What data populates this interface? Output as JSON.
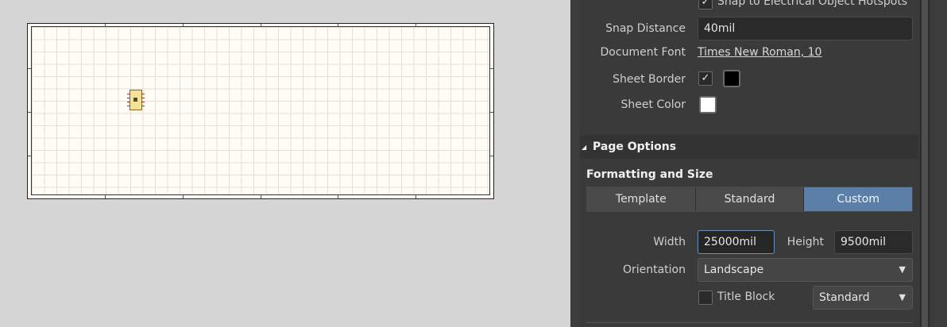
{
  "properties": {
    "snap_hotspots_label": "Snap to Electrical Object Hotspots",
    "snap_distance_label": "Snap Distance",
    "snap_distance_value": "40mil",
    "document_font_label": "Document Font",
    "document_font_value": "Times New Roman, 10",
    "sheet_border_label": "Sheet Border",
    "sheet_border_color": "#000000",
    "sheet_color_label": "Sheet Color",
    "sheet_color": "#ffffff",
    "check_glyph": "✓"
  },
  "page_options": {
    "section_title": "Page Options",
    "collapse_glyph": "◢",
    "formatting_title": "Formatting and Size",
    "modes": [
      {
        "label": "Template",
        "active": false
      },
      {
        "label": "Standard",
        "active": false
      },
      {
        "label": "Custom",
        "active": true
      }
    ],
    "width_label": "Width",
    "width_value": "25000mil",
    "height_label": "Height",
    "height_value": "9500mil",
    "orientation_label": "Orientation",
    "orientation_value": "Landscape",
    "title_block_label": "Title Block",
    "title_block_value": "Standard",
    "dropdown_glyph": "▼"
  },
  "colors": {
    "accent": "#5b7fa6",
    "panel_bg": "#3a3a3a",
    "canvas_bg": "#d5d5d5"
  }
}
